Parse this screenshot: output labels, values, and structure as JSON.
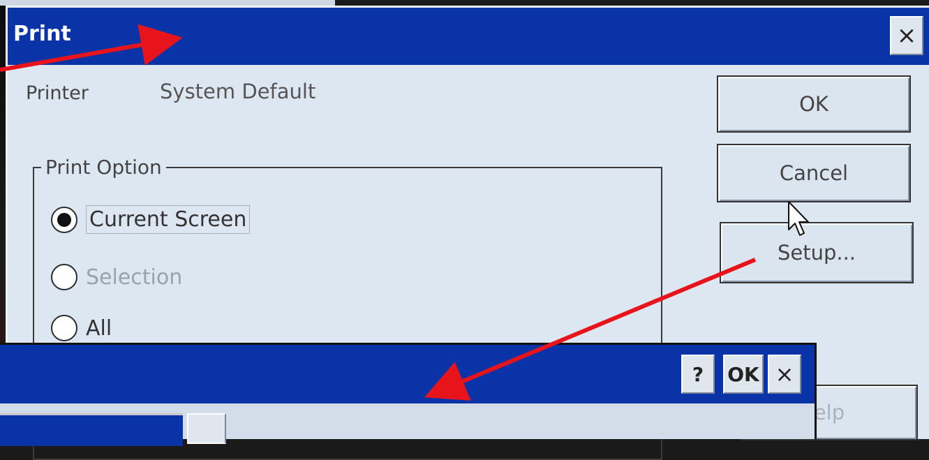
{
  "print_dialog": {
    "title": "Print",
    "close_glyph": "×",
    "printer_label": "Printer",
    "printer_value": "System Default",
    "group_title": "Print Option",
    "options": [
      {
        "label": "Current Screen",
        "selected": true,
        "enabled": true
      },
      {
        "label": "Selection",
        "selected": false,
        "enabled": false
      },
      {
        "label": "All",
        "selected": false,
        "enabled": true
      }
    ],
    "buttons": {
      "ok": "OK",
      "cancel": "Cancel",
      "setup": "Setup...",
      "help": "elp"
    }
  },
  "setup_dialog": {
    "help_glyph": "?",
    "ok": "OK",
    "close_glyph": "×"
  },
  "colors": {
    "titlebar": "#0a33a8",
    "dialog_bg": "#dce7f1",
    "arrow": "#e8141b"
  },
  "icons": [
    "close-icon",
    "help-icon",
    "mouse-cursor-icon",
    "radio-icon"
  ]
}
